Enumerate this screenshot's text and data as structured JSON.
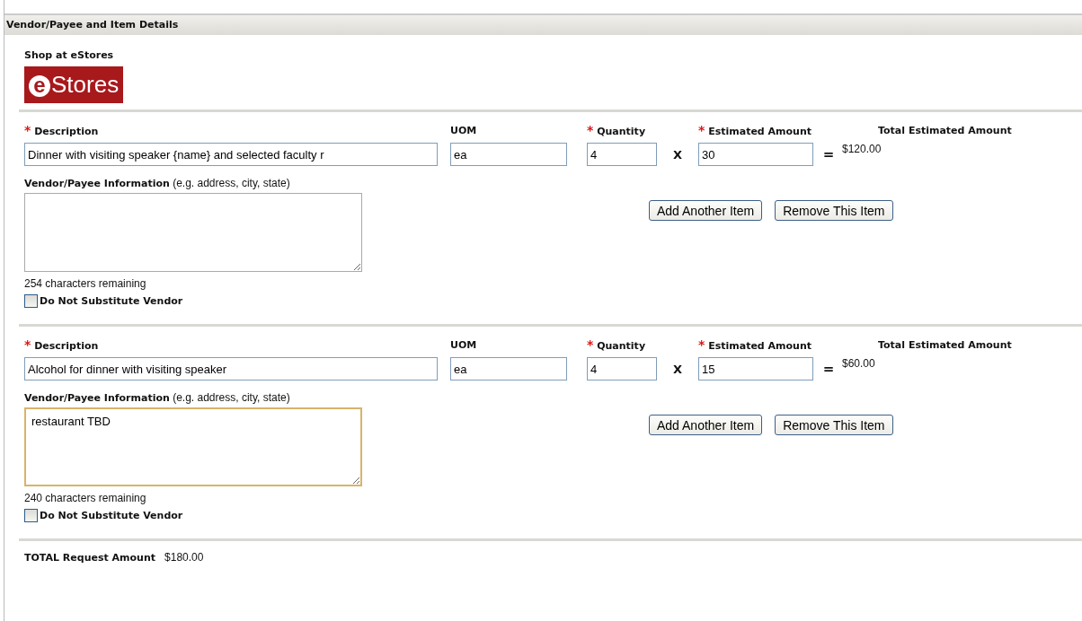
{
  "section": {
    "title": "Vendor/Payee and Item Details"
  },
  "estores": {
    "heading": "Shop at eStores",
    "logo_mark": "e",
    "logo_text": "Stores"
  },
  "items": [
    {
      "labels": {
        "description": "Description",
        "uom": "UOM",
        "quantity": "Quantity",
        "estimated_amount": "Estimated Amount",
        "total": "Total Estimated Amount",
        "required_mark": "*",
        "times": "X",
        "equals": "="
      },
      "description": "Dinner with visiting speaker {name} and selected faculty r",
      "uom": "ea",
      "quantity": "4",
      "estimated_amount": "30",
      "total": "$120.00",
      "vendor_label": "Vendor/Payee Information",
      "vendor_hint": "(e.g. address, city, state)",
      "vendor_focused": false,
      "remaining": "254 characters remaining",
      "do_not_substitute": {
        "label": "Do Not Substitute Vendor",
        "checked": false
      },
      "buttons": [
        "Add Another Item",
        "Remove This Item"
      ]
    },
    {
      "labels": {
        "description": "Description",
        "uom": "UOM",
        "quantity": "Quantity",
        "estimated_amount": "Estimated Amount",
        "total": "Total Estimated Amount",
        "required_mark": "*",
        "times": "X",
        "equals": "="
      },
      "description": "Alcohol for dinner with visiting speaker",
      "uom": "ea",
      "quantity": "4",
      "estimated_amount": "15",
      "total": "$60.00",
      "vendor_label": "Vendor/Payee Information",
      "vendor_hint": "(e.g. address, city, state)",
      "vendor_info": "restaurant TBD",
      "vendor_focused": true,
      "remaining": "240 characters remaining",
      "do_not_substitute": {
        "label": "Do Not Substitute Vendor",
        "checked": false
      },
      "buttons": [
        "Add Another Item",
        "Remove This Item"
      ]
    }
  ],
  "total_request": {
    "label": "TOTAL Request Amount",
    "value": "$180.00"
  }
}
